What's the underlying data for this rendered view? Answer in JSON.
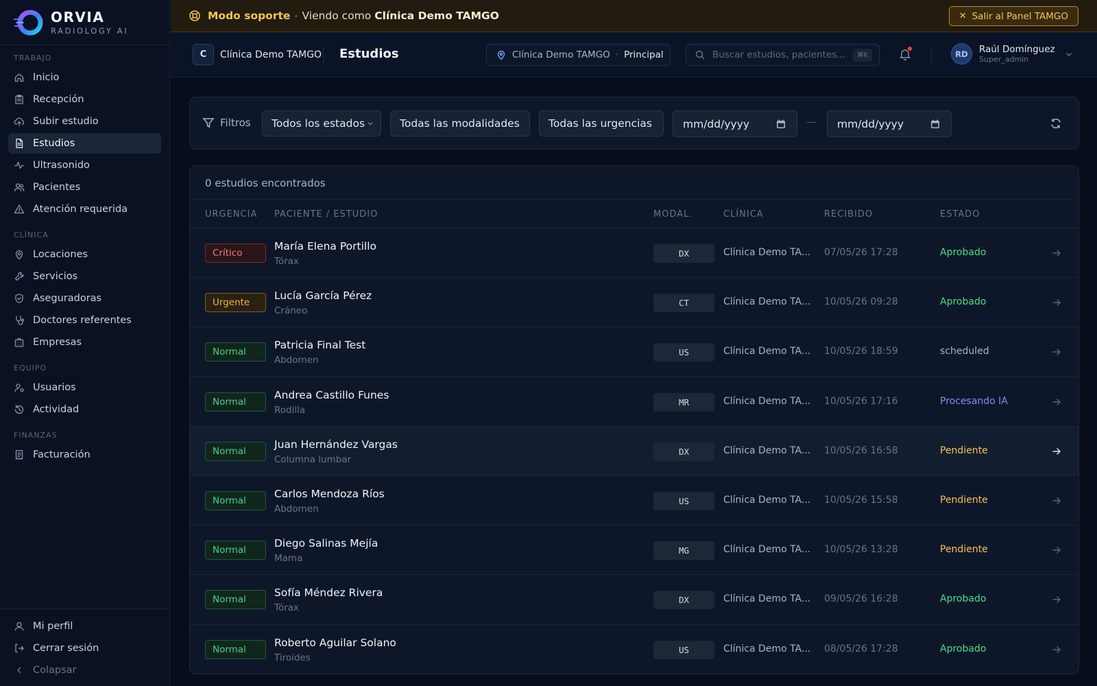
{
  "brand": {
    "name": "ORVIA",
    "tagline": "RADIOLOGY AI"
  },
  "sidebar": {
    "sections": [
      {
        "title": "TRABAJO",
        "items": [
          {
            "label": "Inicio",
            "icon": "home-icon"
          },
          {
            "label": "Recepción",
            "icon": "clipboard-icon"
          },
          {
            "label": "Subir estudio",
            "icon": "upload-cloud-icon"
          },
          {
            "label": "Estudios",
            "icon": "file-text-icon",
            "active": true
          },
          {
            "label": "Ultrasonido",
            "icon": "activity-icon"
          },
          {
            "label": "Pacientes",
            "icon": "users-icon"
          },
          {
            "label": "Atención requerida",
            "icon": "alert-triangle-icon"
          }
        ]
      },
      {
        "title": "CLÍNICA",
        "items": [
          {
            "label": "Locaciones",
            "icon": "map-pin-icon"
          },
          {
            "label": "Servicios",
            "icon": "wrench-icon"
          },
          {
            "label": "Aseguradoras",
            "icon": "shield-icon"
          },
          {
            "label": "Doctores referentes",
            "icon": "stethoscope-icon"
          },
          {
            "label": "Empresas",
            "icon": "building-icon"
          }
        ]
      },
      {
        "title": "EQUIPO",
        "items": [
          {
            "label": "Usuarios",
            "icon": "user-cog-icon"
          },
          {
            "label": "Actividad",
            "icon": "history-icon"
          }
        ]
      },
      {
        "title": "FINANZAS",
        "items": [
          {
            "label": "Facturación",
            "icon": "receipt-icon"
          }
        ]
      }
    ],
    "bottom": {
      "profile": "Mi perfil",
      "logout": "Cerrar sesión",
      "collapse": "Colapsar"
    }
  },
  "banner": {
    "mode": "Modo soporte",
    "separator": "·",
    "viewing": "Viendo como",
    "clinic": "Clínica Demo TAMGO",
    "exit_label": "Salir al Panel TAMGO"
  },
  "header": {
    "clinic_initial": "C",
    "clinic_name": "Clínica Demo TAMGO",
    "page_title": "Estudios",
    "location": "Clínica Demo TAMGO",
    "location_dot": "·",
    "branch": "Principal",
    "search_placeholder": "Buscar estudios, pacientes...",
    "search_kbd": "⌘K",
    "user_initials": "RD",
    "user_name": "Raúl Domínguez",
    "user_role": "Super_admin"
  },
  "filters": {
    "label": "Filtros",
    "status": "Todos los estados",
    "modality": "Todas las modalidades",
    "urgency": "Todas las urgencias",
    "date_from": "mm/dd/yyyy",
    "date_sep": "—",
    "date_to": "mm/dd/yyyy"
  },
  "table": {
    "count_text": "0 estudios encontrados",
    "columns": {
      "urgency": "URGENCIA",
      "patient": "PACIENTE / ESTUDIO",
      "modality": "MODAL.",
      "clinic": "CLÍNICA",
      "received": "RECIBIDO",
      "status": "ESTADO"
    },
    "rows": [
      {
        "urgency": "Crítico",
        "urgency_kind": "critico",
        "patient": "María Elena Portillo",
        "study": "Tórax",
        "modality": "DX",
        "clinic": "Clínica Demo TA...",
        "received": "07/05/26 17:28",
        "status": "Aprobado",
        "status_color": "#4ade80"
      },
      {
        "urgency": "Urgente",
        "urgency_kind": "urgente",
        "patient": "Lucía García Pérez",
        "study": "Cráneo",
        "modality": "CT",
        "clinic": "Clínica Demo TA...",
        "received": "10/05/26 09:28",
        "status": "Aprobado",
        "status_color": "#4ade80"
      },
      {
        "urgency": "Normal",
        "urgency_kind": "normal",
        "patient": "Patricia Final Test",
        "study": "Abdomen",
        "modality": "US",
        "clinic": "Clínica Demo TA...",
        "received": "10/05/26 18:59",
        "status": "scheduled",
        "status_color": "#aab4c4"
      },
      {
        "urgency": "Normal",
        "urgency_kind": "normal",
        "patient": "Andrea Castillo Funes",
        "study": "Rodilla",
        "modality": "MR",
        "clinic": "Clínica Demo TA...",
        "received": "10/05/26 17:16",
        "status": "Procesando IA",
        "status_color": "#818cf8"
      },
      {
        "urgency": "Normal",
        "urgency_kind": "normal",
        "patient": "Juan Hernández Vargas",
        "study": "Columna lumbar",
        "modality": "DX",
        "clinic": "Clínica Demo TA...",
        "received": "10/05/26 16:58",
        "status": "Pendiente",
        "status_color": "#f5c451"
      },
      {
        "urgency": "Normal",
        "urgency_kind": "normal",
        "patient": "Carlos Mendoza Ríos",
        "study": "Abdomen",
        "modality": "US",
        "clinic": "Clínica Demo TA...",
        "received": "10/05/26 15:58",
        "status": "Pendiente",
        "status_color": "#f5c451"
      },
      {
        "urgency": "Normal",
        "urgency_kind": "normal",
        "patient": "Diego Salinas Mejía",
        "study": "Mama",
        "modality": "MG",
        "clinic": "Clínica Demo TA...",
        "received": "10/05/26 13:28",
        "status": "Pendiente",
        "status_color": "#f5c451"
      },
      {
        "urgency": "Normal",
        "urgency_kind": "normal",
        "patient": "Sofía Méndez Rivera",
        "study": "Tórax",
        "modality": "DX",
        "clinic": "Clínica Demo TA...",
        "received": "09/05/26 16:28",
        "status": "Aprobado",
        "status_color": "#4ade80"
      },
      {
        "urgency": "Normal",
        "urgency_kind": "normal",
        "patient": "Roberto Aguilar Solano",
        "study": "Tiroides",
        "modality": "US",
        "clinic": "Clínica Demo TA...",
        "received": "08/05/26 17:28",
        "status": "Aprobado",
        "status_color": "#4ade80"
      }
    ]
  },
  "colors": {
    "accent": "#f5c451",
    "bg": "#070d1b",
    "panel": "#0e1729"
  }
}
